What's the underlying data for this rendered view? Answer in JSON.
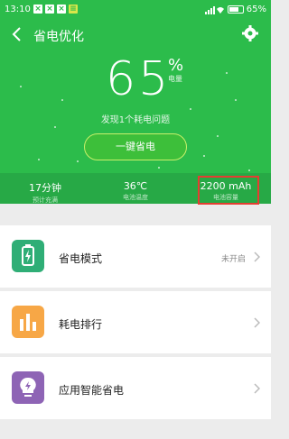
{
  "statusbar": {
    "time": "13:10",
    "battery": "65%",
    "notifications": [
      "×",
      "×",
      "×",
      "≡"
    ]
  },
  "header": {
    "title": "省电优化"
  },
  "battery": {
    "level": "65",
    "percent_sign": "%",
    "unit_label": "电量",
    "level_fraction": 0.65
  },
  "issues_text": "发现1个耗电问题",
  "cta_label": "一键省电",
  "stats": [
    {
      "value": "17分钟",
      "label": "预计充满"
    },
    {
      "value": "36℃",
      "label": "电池温度"
    },
    {
      "value": "2200 mAh",
      "label": "电池容量"
    }
  ],
  "cards": [
    {
      "label": "省电模式",
      "status": "未开启",
      "icon": "battery-saver-icon",
      "color": "#2fae76"
    },
    {
      "label": "耗电排行",
      "status": "",
      "icon": "bar-chart-icon",
      "color": "#f7a746"
    },
    {
      "label": "应用智能省电",
      "status": "",
      "icon": "bulb-icon",
      "color": "#8e64b5"
    }
  ],
  "colors": {
    "hero": "#2cbc4b",
    "highlight": "#e53d31",
    "cta_border": "#c8f06a"
  }
}
